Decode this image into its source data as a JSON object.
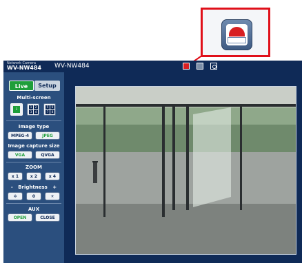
{
  "header": {
    "brand_line": "Network Camera",
    "model_short": "WV-NW484",
    "title": "WV-NW484",
    "icons": [
      "alarm-icon",
      "sdcard-icon",
      "snapshot-icon"
    ]
  },
  "callout": {
    "icon": "alarm-icon",
    "accent_color": "#e0101a"
  },
  "sidebar": {
    "tabs": [
      {
        "label": "Live",
        "active": true
      },
      {
        "label": "Setup",
        "active": false
      }
    ],
    "multiscreen": {
      "label": "Multi-screen",
      "options": [
        "1",
        "1-4",
        "5-8"
      ]
    },
    "image_type": {
      "label": "Image type",
      "options": [
        "MPEG-4",
        "JPEG"
      ],
      "selected": "JPEG"
    },
    "capture_size": {
      "label": "Image capture size",
      "options": [
        "VGA",
        "QVGA"
      ],
      "selected": "VGA"
    },
    "zoom": {
      "label": "ZOOM",
      "options": [
        "x 1",
        "x 2",
        "x 4"
      ]
    },
    "brightness": {
      "label": "Brightness",
      "minus": "-",
      "plus": "+",
      "reset": "0"
    },
    "aux": {
      "label": "AUX",
      "open": "OPEN",
      "close": "CLOSE"
    }
  },
  "colors": {
    "header": "#0f2a57",
    "sidebar": "#2b4f7e",
    "active_green": "#1e9e3a"
  }
}
